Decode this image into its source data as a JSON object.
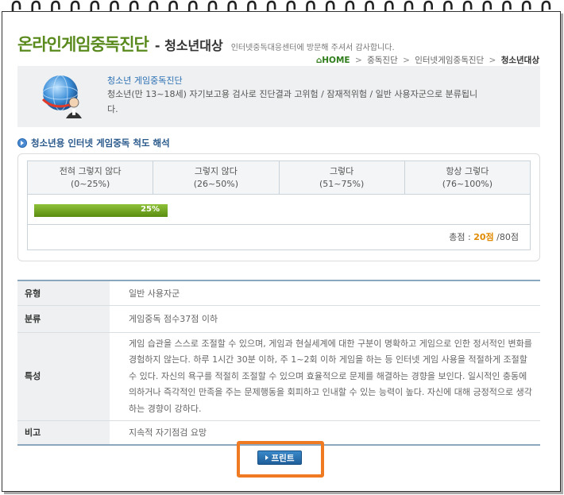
{
  "header": {
    "title": "온라인게임중독진단",
    "dash_sub": "- 청소년대상",
    "note": "인터넷중독대응센터에 방문해 주셔서 감사합니다."
  },
  "breadcrumb": {
    "home": "HOME",
    "items": [
      "중독진단",
      "인터넷게임중독진단"
    ],
    "current": "청소년대상"
  },
  "info": {
    "title": "청소년 게임중독진단",
    "description": "청소년(만 13~18세) 자기보고용 검사로 진단결과 고위험 / 잠재적위험 / 일반 사용자군으로 분류됩니다."
  },
  "section": {
    "title": "청소년용 인터넷 게임중독 척도 해석"
  },
  "scale": {
    "columns": [
      {
        "label": "전혀 그렇지 않다",
        "range": "(0~25%)"
      },
      {
        "label": "그렇지 않다",
        "range": "(26~50%)"
      },
      {
        "label": "그렇다",
        "range": "(51~75%)"
      },
      {
        "label": "항상 그렇다",
        "range": "(76~100%)"
      }
    ],
    "progress_percent": 25,
    "progress_label": "25%",
    "score_prefix": "총점 :",
    "score_value": "20점",
    "score_total": "/80점",
    "bar_color": "#6fa21f"
  },
  "details": {
    "rows": [
      {
        "label": "유형",
        "value": "일반 사용자군"
      },
      {
        "label": "분류",
        "value": "게임중독 점수37점 이하"
      },
      {
        "label": "특성",
        "value": "게임 습관을 스스로 조절할 수 있으며, 게임과 현실세계에 대한 구분이 명확하고 게임으로 인한 정서적인 변화를 경험하지 않는다. 하루 1시간 30분 이하, 주 1~2회 이하 게임을 하는 등 인터넷 게임 사용을 적절하게 조절할 수 있다. 자신의 욕구를 적절히 조절할 수 있으며 효율적으로 문제를 해결하는 경향을 보인다. 일시적인 충동에 의하거나 즉각적인 만족을 주는 문제행동을 회피하고 인내할 수 있는 능력이 높다. 자신에 대해 긍정적으로 생각하는 경향이 강하다."
      },
      {
        "label": "비고",
        "value": "지속적 자기점검 요망"
      }
    ]
  },
  "actions": {
    "print_label": "프린트"
  },
  "colors": {
    "title_green": "#5a8a1e",
    "link_blue": "#2a6fb4",
    "highlight_orange": "#f07a22",
    "score_orange": "#e08a00"
  }
}
